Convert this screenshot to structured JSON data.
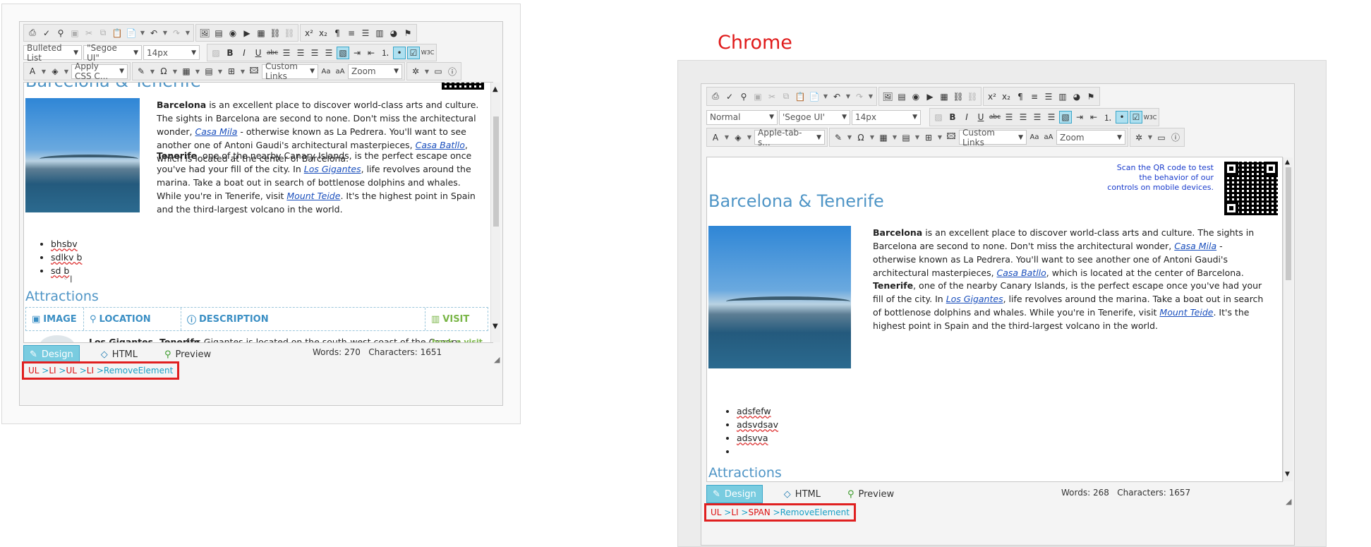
{
  "chrome_label": "Chrome",
  "left": {
    "toolbar": {
      "format_value": "Bulleted List",
      "font_value": "\"Segoe UI\"",
      "size_value": "14px",
      "css_value": "Apply CSS C...",
      "links_value": "Custom Links",
      "zoom_value": "Zoom"
    },
    "content": {
      "title": "Barcelona & Tenerife",
      "p1_b": "Barcelona",
      "p1_a": " is an excellent place to discover world-class arts and culture. The sights in Barcelona are second to none. Don't miss the architectural wonder, ",
      "p1_link1": "Casa Mila",
      "p1_c": " - otherwise known as La Pedrera. You'll want to see another one of Antoni Gaudi's architectural masterpieces, ",
      "p1_link2": "Casa Batllo",
      "p1_d": ", which is located at the center of Barcelona.",
      "p2_b": "Tenerife",
      "p2_a": ", one of the nearby Canary Islands, is the perfect escape once you've had your fill of the city. In ",
      "p2_link1": "Los Gigantes",
      "p2_c": ", life revolves around the marina. Take a boat out in search of bottlenose dolphins and whales. While you're in Tenerife, visit ",
      "p2_link2": "Mount Teide",
      "p2_d": ". It's the highest point in Spain and the third-largest volcano in the world.",
      "bullets": [
        "bhsbv",
        "sdlkv b",
        "sd b"
      ],
      "attractions": "Attractions",
      "table_headers": [
        "IMAGE",
        "LOCATION",
        "DESCRIPTION",
        "VISIT"
      ],
      "row_location": "Los Gigantes, Tenerife",
      "row_description": "Los Gigantes is located on the south-west coast of the Canary",
      "row_visit": "book a visit >>"
    },
    "modes": {
      "design": "Design",
      "html": "HTML",
      "preview": "Preview"
    },
    "counts": "Words: 270   Characters: 1651",
    "path": {
      "p1": "UL",
      "p2": "LI",
      "p3": "UL",
      "p4": "LI",
      "remove": "RemoveElement"
    }
  },
  "right": {
    "toolbar": {
      "format_value": "Normal",
      "font_value": "'Segoe UI'",
      "size_value": "14px",
      "css_value": "Apple-tab-s...",
      "links_value": "Custom Links",
      "zoom_value": "Zoom"
    },
    "content": {
      "qr_text": "Scan the QR code to test the behavior of our controls on mobile devices.",
      "title": "Barcelona & Tenerife",
      "bullets": [
        "adsfefw",
        "adsvdsav",
        "adsvva",
        ""
      ],
      "attractions": "Attractions"
    },
    "modes": {
      "design": "Design",
      "html": "HTML",
      "preview": "Preview"
    },
    "counts": "Words: 268   Characters: 1657",
    "path": {
      "p1": "UL",
      "p2": "LI",
      "p3": "SPAN",
      "remove": "RemoveElement"
    }
  }
}
